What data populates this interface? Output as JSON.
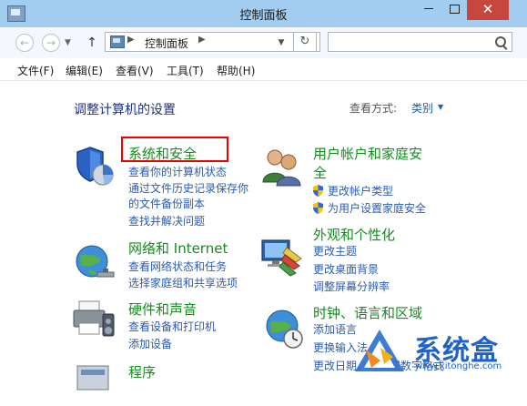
{
  "window": {
    "title": "控制面板",
    "close_glyph": "✕"
  },
  "address": {
    "crumb": "控制面板",
    "search_placeholder": ""
  },
  "menu": [
    "文件(F)",
    "编辑(E)",
    "查看(V)",
    "工具(T)",
    "帮助(H)"
  ],
  "content": {
    "heading": "调整计算机的设置",
    "view_by_label": "查看方式:",
    "view_by_value": "类别"
  },
  "categories": [
    {
      "title": "系统和安全",
      "links": [
        "查看你的计算机状态",
        "通过文件历史记录保存你",
        "的文件备份副本",
        "查找并解决问题"
      ]
    },
    {
      "title_line1": "用户帐户和家庭安",
      "title_line2": "全",
      "links": [
        "更改帐户类型",
        "为用户设置家庭安全"
      ]
    },
    {
      "title": "网络和 Internet",
      "links": [
        "查看网络状态和任务",
        "选择家庭组和共享选项"
      ]
    },
    {
      "title": "外观和个性化",
      "links": [
        "更改主题",
        "更改桌面背景",
        "调整屏幕分辨率"
      ]
    },
    {
      "title": "硬件和声音",
      "links": [
        "查看设备和打印机",
        "添加设备"
      ]
    },
    {
      "title": "时钟、语言和区域",
      "links": [
        "添加语言",
        "更换输入法",
        "更改日期、时间或数字格式"
      ]
    },
    {
      "title": "程序"
    }
  ],
  "watermark": {
    "text": "系统盒",
    "url": "www.xitonghe.com"
  },
  "colors": {
    "titlebar": "#a2cdf0",
    "heading": "#1e3287",
    "category_green": "#148c1e",
    "link_blue": "#2a5bb1",
    "highlight_red": "#e00000"
  }
}
